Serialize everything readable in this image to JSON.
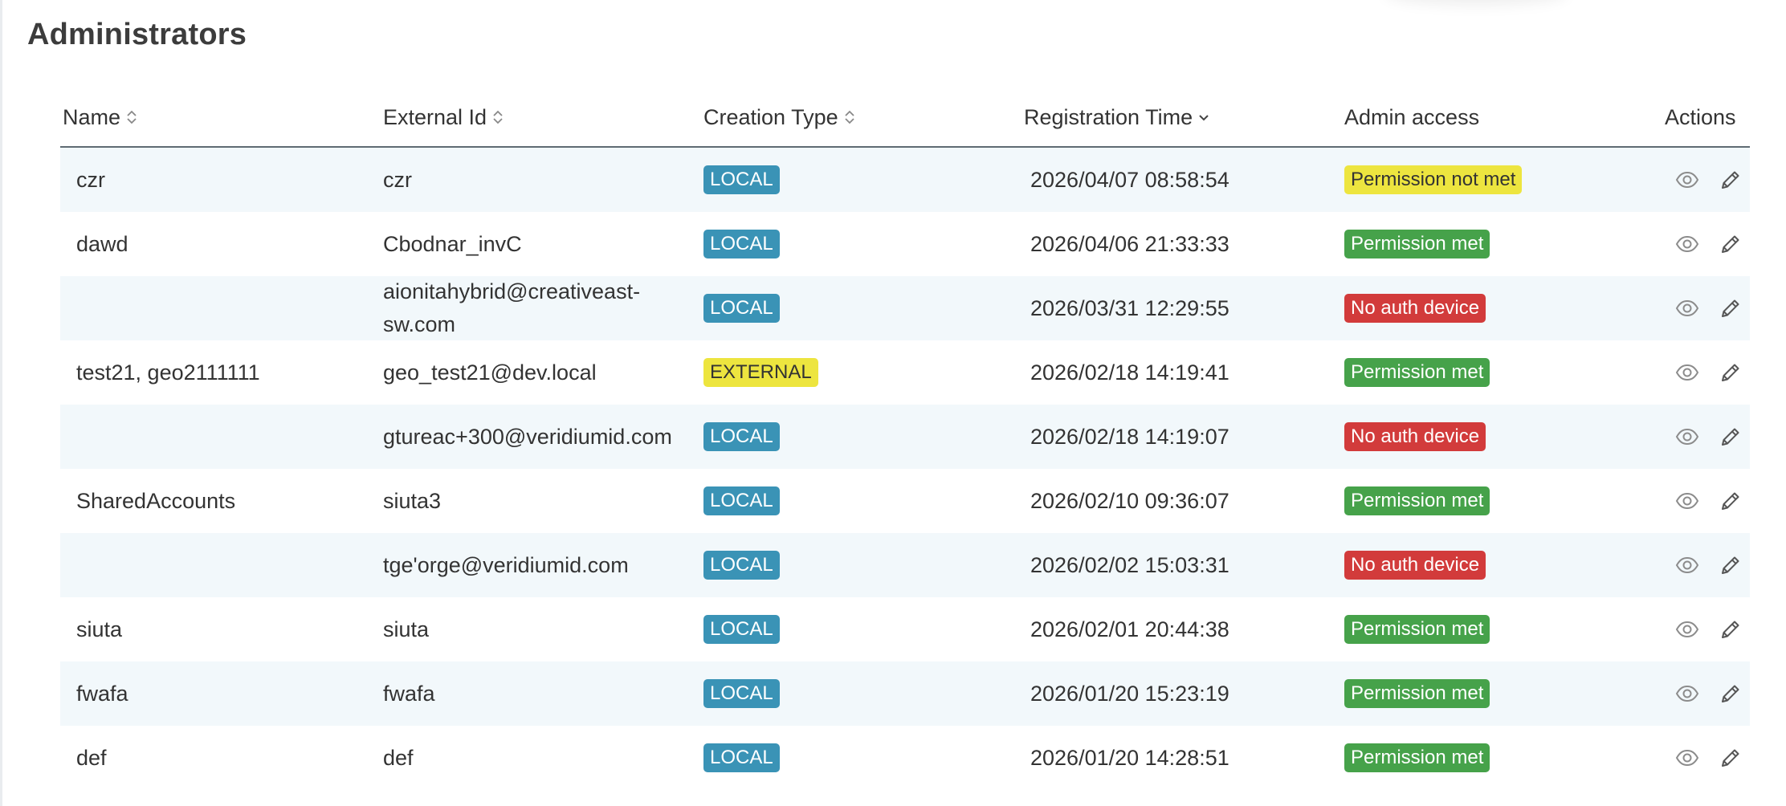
{
  "page": {
    "title": "Administrators"
  },
  "table": {
    "columns": {
      "name": "Name",
      "external_id": "External Id",
      "creation_type": "Creation Type",
      "registration_time": "Registration Time",
      "admin_access": "Admin access",
      "actions": "Actions"
    },
    "sort": {
      "column": "Registration Time",
      "direction": "descending"
    },
    "rows": [
      {
        "name": "czr",
        "external_id": "czr",
        "creation_type": "LOCAL",
        "registration_time": "2026/04/07 08:58:54",
        "admin_access": "Permission not met"
      },
      {
        "name": "dawd",
        "external_id": "Cbodnar_invC",
        "creation_type": "LOCAL",
        "registration_time": "2026/04/06 21:33:33",
        "admin_access": "Permission met"
      },
      {
        "name": "",
        "external_id": "aionitahybrid@creativeast-sw.com",
        "creation_type": "LOCAL",
        "registration_time": "2026/03/31 12:29:55",
        "admin_access": "No auth device"
      },
      {
        "name": "test21, geo2111111",
        "external_id": "geo_test21@dev.local",
        "creation_type": "EXTERNAL",
        "registration_time": "2026/02/18 14:19:41",
        "admin_access": "Permission met"
      },
      {
        "name": "",
        "external_id": "gtureac+300@veridiumid.com",
        "creation_type": "LOCAL",
        "registration_time": "2026/02/18 14:19:07",
        "admin_access": "No auth device"
      },
      {
        "name": "SharedAccounts",
        "external_id": "siuta3",
        "creation_type": "LOCAL",
        "registration_time": "2026/02/10 09:36:07",
        "admin_access": "Permission met"
      },
      {
        "name": "",
        "external_id": " tge'orge@veridiumid.com",
        "creation_type": "LOCAL",
        "registration_time": "2026/02/02 15:03:31",
        "admin_access": "No auth device"
      },
      {
        "name": "siuta",
        "external_id": "siuta",
        "creation_type": "LOCAL",
        "registration_time": "2026/02/01 20:44:38",
        "admin_access": "Permission met"
      },
      {
        "name": "fwafa",
        "external_id": "fwafa",
        "creation_type": "LOCAL",
        "registration_time": "2026/01/20 15:23:19",
        "admin_access": "Permission met"
      },
      {
        "name": "def",
        "external_id": "def",
        "creation_type": "LOCAL",
        "registration_time": "2026/01/20 14:28:51",
        "admin_access": "Permission met"
      }
    ],
    "row_actions": [
      "eye-icon",
      "pencil-icon"
    ]
  },
  "colors": {
    "local_badge": "#3a93b6",
    "external_badge": "#ede53f",
    "permission_met": "#46a24a",
    "permission_not_met": "#ede53f",
    "no_auth_device": "#d23b3b",
    "row_stripe": "#f2f8fb",
    "header_rule": "#5f6b73"
  }
}
